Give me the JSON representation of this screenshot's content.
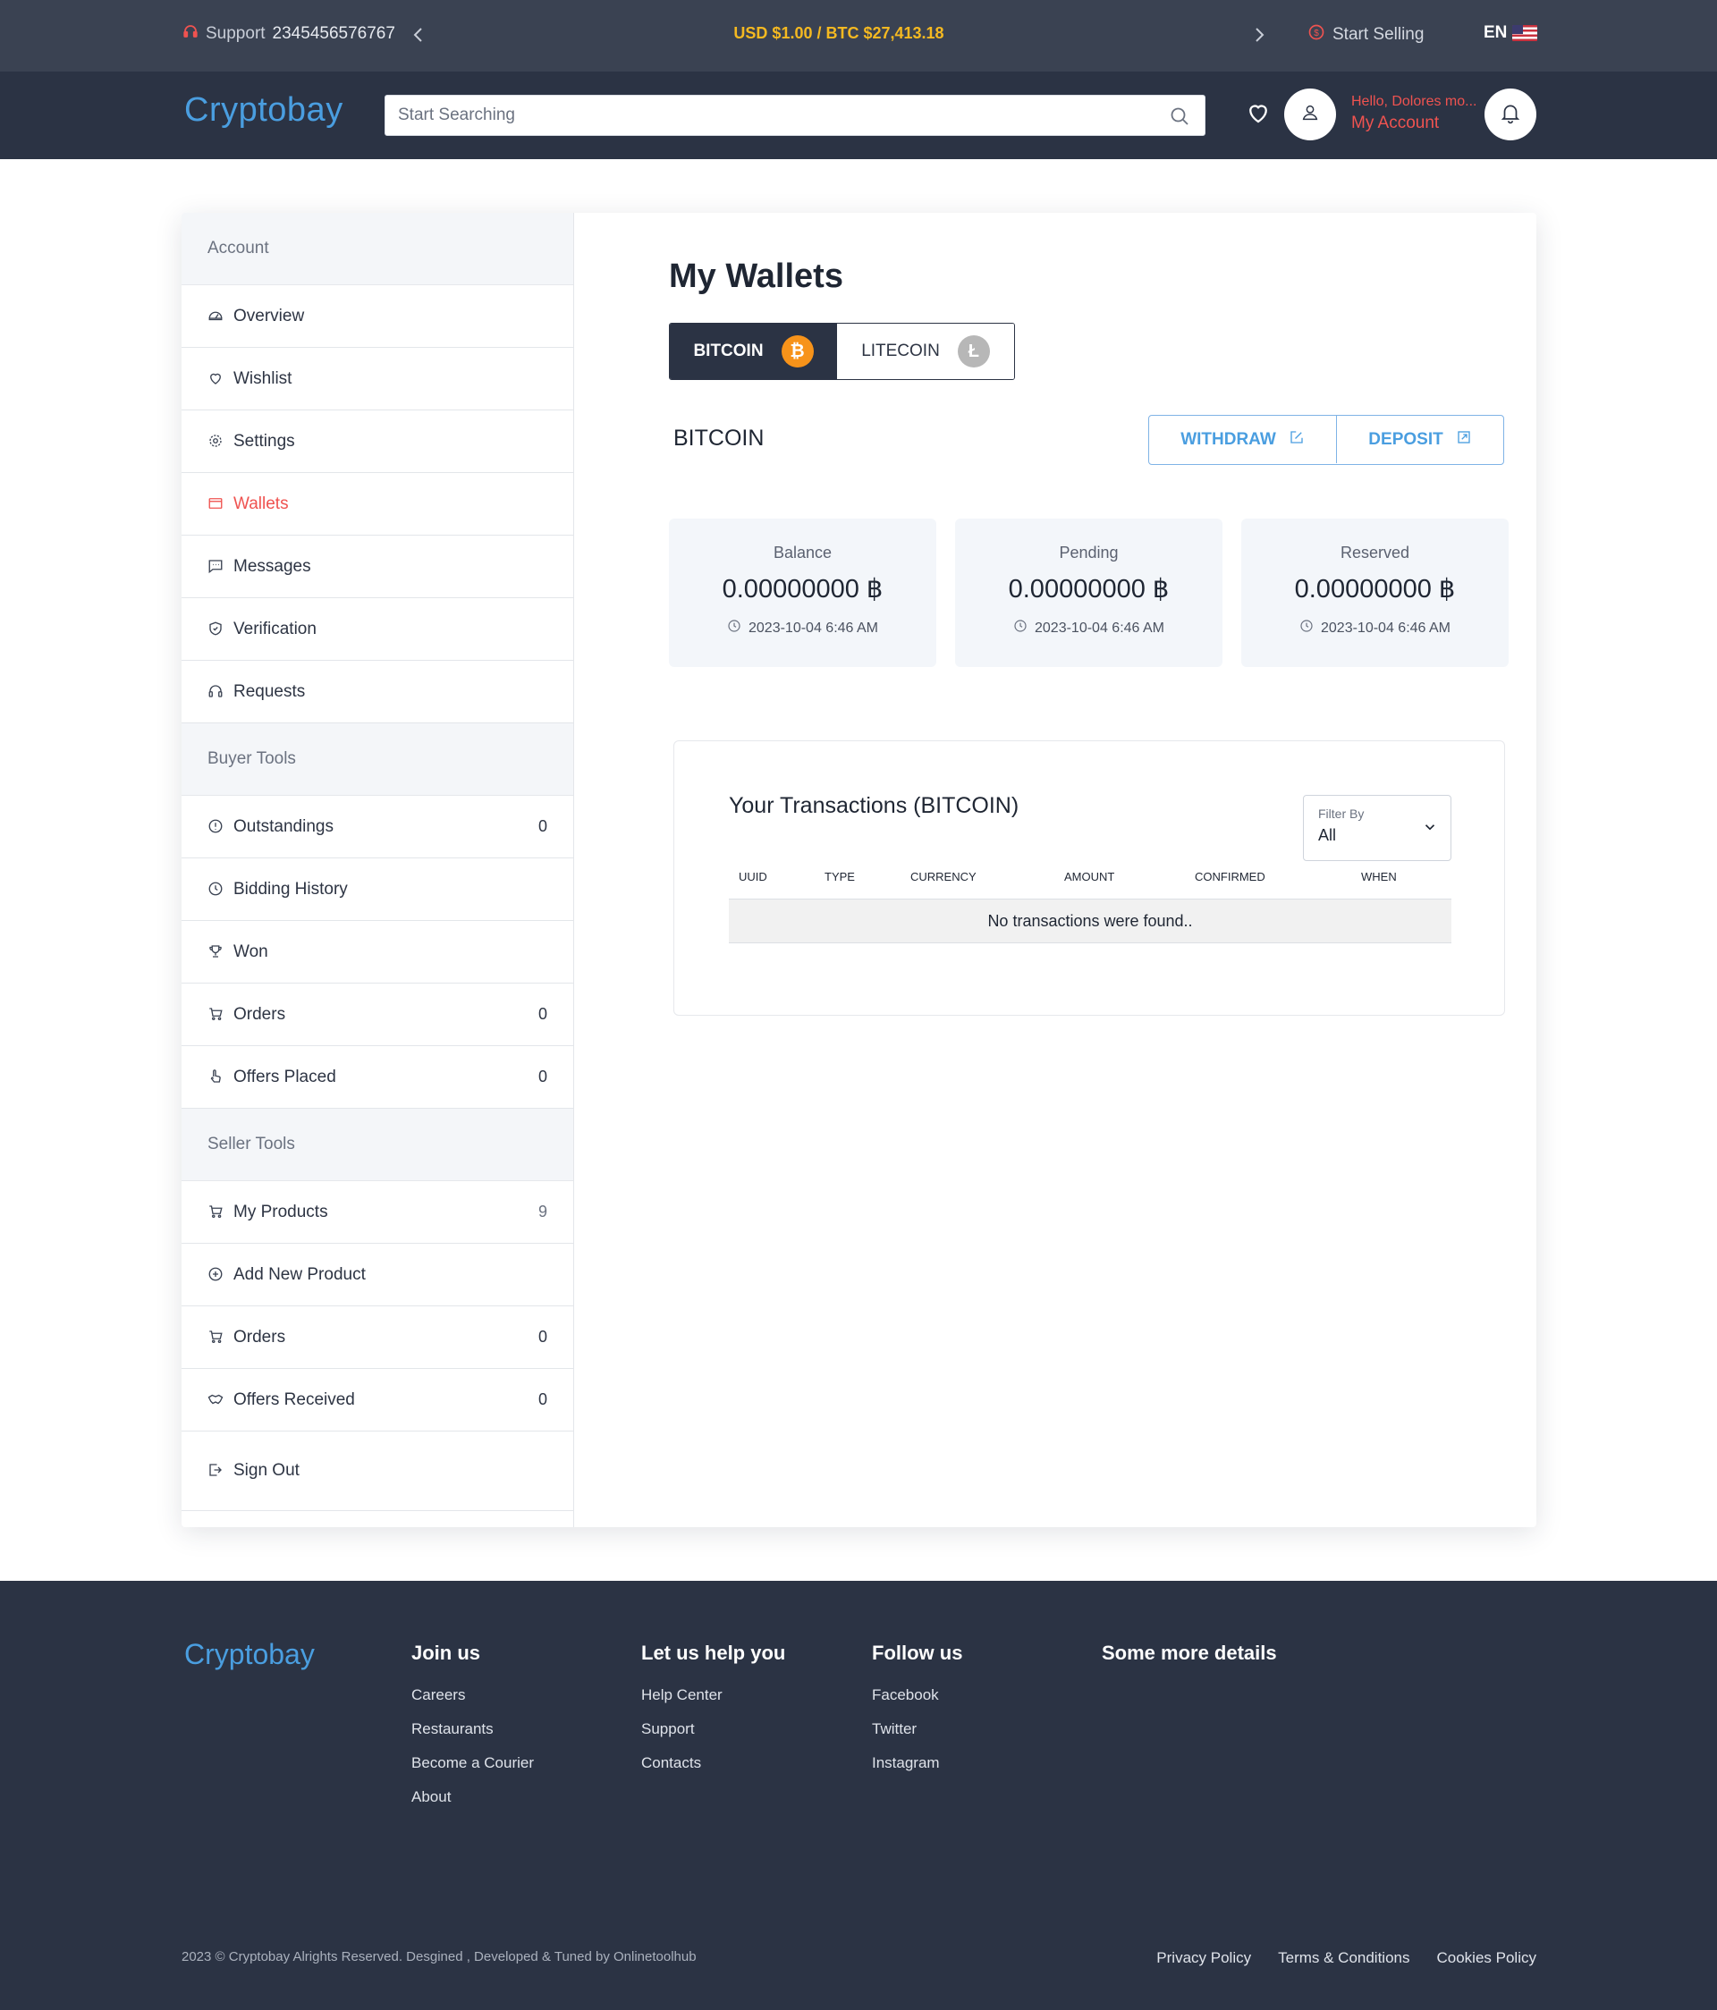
{
  "topbar": {
    "support_label": "Support",
    "support_number": "2345456576767",
    "rate": "USD $1.00 / BTC $27,413.18",
    "start_selling": "Start Selling",
    "language": "EN"
  },
  "header": {
    "logo": "Cryptobay",
    "search_placeholder": "Start Searching",
    "greeting": "Hello, Dolores mo...",
    "account_label": "My Account"
  },
  "sidebar": {
    "account_heading": "Account",
    "account_items": [
      {
        "label": "Overview",
        "icon": "dashboard-icon"
      },
      {
        "label": "Wishlist",
        "icon": "heart-icon"
      },
      {
        "label": "Settings",
        "icon": "gear-icon"
      },
      {
        "label": "Wallets",
        "icon": "wallet-icon",
        "active": true
      },
      {
        "label": "Messages",
        "icon": "message-icon"
      },
      {
        "label": "Verification",
        "icon": "shield-icon"
      },
      {
        "label": "Requests",
        "icon": "headset-icon"
      }
    ],
    "buyer_heading": "Buyer Tools",
    "buyer_items": [
      {
        "label": "Outstandings",
        "count": "0",
        "icon": "alert-circle-icon"
      },
      {
        "label": "Bidding History",
        "icon": "clock-icon"
      },
      {
        "label": "Won",
        "icon": "trophy-icon"
      },
      {
        "label": "Orders",
        "count": "0",
        "icon": "cart-icon"
      },
      {
        "label": "Offers Placed",
        "count": "0",
        "icon": "hand-icon"
      }
    ],
    "seller_heading": "Seller Tools",
    "seller_items": [
      {
        "label": "My Products",
        "count": "9",
        "icon": "cart-icon"
      },
      {
        "label": "Add New Product",
        "icon": "plus-circle-icon"
      },
      {
        "label": "Orders",
        "count": "0",
        "icon": "cart-icon"
      },
      {
        "label": "Offers Received",
        "count": "0",
        "icon": "handshake-icon"
      },
      {
        "label": "Sign Out",
        "icon": "sign-out-icon"
      }
    ]
  },
  "main": {
    "title": "My Wallets",
    "tabs": [
      {
        "label": "BITCOIN",
        "symbol": "₿",
        "active": true
      },
      {
        "label": "LITECOIN",
        "symbol": "Ł",
        "active": false
      }
    ],
    "wallet_name": "BITCOIN",
    "withdraw_label": "WITHDRAW",
    "deposit_label": "DEPOSIT",
    "stats": [
      {
        "label": "Balance",
        "value": "0.00000000 ฿",
        "time": "2023-10-04 6:46 AM"
      },
      {
        "label": "Pending",
        "value": "0.00000000 ฿",
        "time": "2023-10-04 6:46 AM"
      },
      {
        "label": "Reserved",
        "value": "0.00000000 ฿",
        "time": "2023-10-04 6:46 AM"
      }
    ],
    "transactions": {
      "title": "Your Transactions (BITCOIN)",
      "filter_label": "Filter By",
      "filter_value": "All",
      "columns": [
        "UUID",
        "TYPE",
        "CURRENCY",
        "AMOUNT",
        "CONFIRMED",
        "WHEN"
      ],
      "empty_message": "No transactions were found.."
    }
  },
  "footer": {
    "logo": "Cryptobay",
    "columns": [
      {
        "heading": "Join us",
        "links": [
          "Careers",
          "Restaurants",
          "Become a Courier",
          "About"
        ]
      },
      {
        "heading": "Let us help you",
        "links": [
          "Help Center",
          "Support",
          "Contacts"
        ]
      },
      {
        "heading": "Follow us",
        "links": [
          "Facebook",
          "Twitter",
          "Instagram"
        ]
      },
      {
        "heading": "Some more details",
        "links": []
      }
    ],
    "copyright": "2023 © Cryptobay Alrights Reserved. Desgined , Developed & Tuned by Onlinetoolhub",
    "legal": [
      "Privacy Policy",
      "Terms & Conditions",
      "Cookies Policy"
    ]
  },
  "colors": {
    "accent_blue": "#4a9ee0",
    "accent_red": "#ef5350",
    "rate_yellow": "#f5b921",
    "dark_navy": "#2b3344",
    "bitcoin_orange": "#f7931a"
  }
}
